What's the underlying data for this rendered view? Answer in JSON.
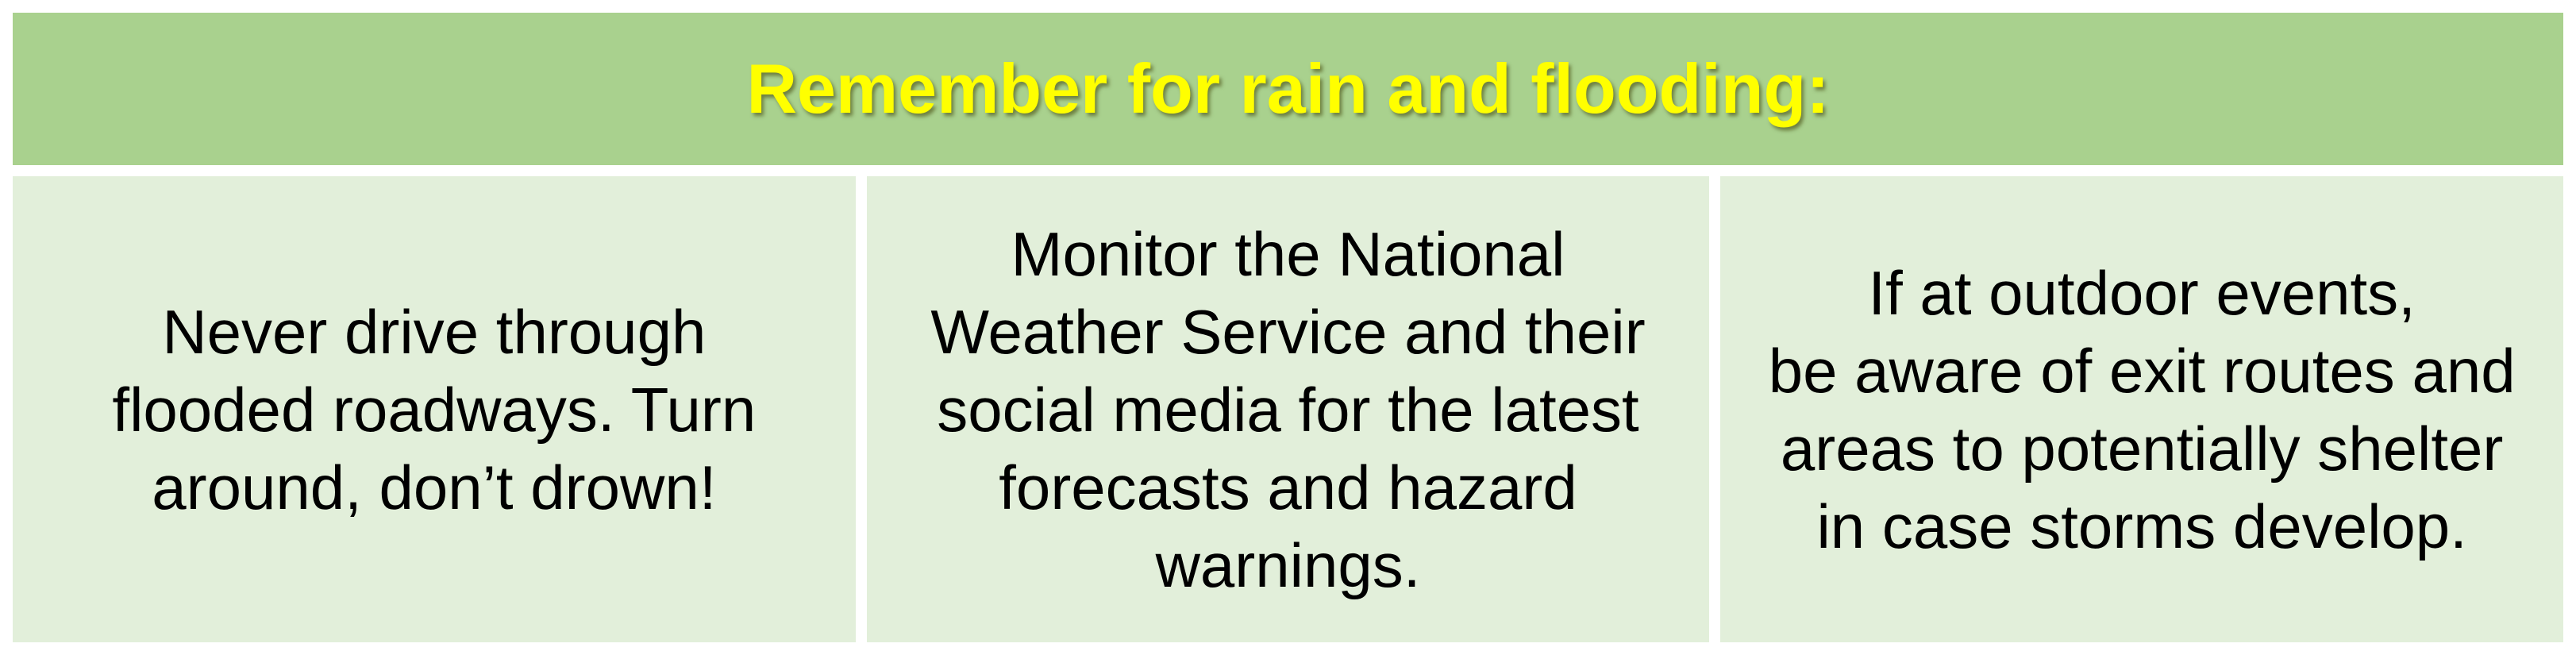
{
  "header": {
    "title": "Remember for rain and flooding:"
  },
  "tips": [
    {
      "text": "Never drive through\nflooded roadways. Turn\naround, don’t drown!"
    },
    {
      "text": "Monitor the National\nWeather Service and their\nsocial media for the latest\nforecasts and hazard\nwarnings."
    },
    {
      "text": "If at outdoor events,\nbe aware of exit routes and\nareas to potentially shelter\nin case storms develop."
    }
  ],
  "colors": {
    "header_background": "#a9d18e",
    "header_text": "#ffff00",
    "cell_background": "#e2efda",
    "body_text": "#000000"
  }
}
